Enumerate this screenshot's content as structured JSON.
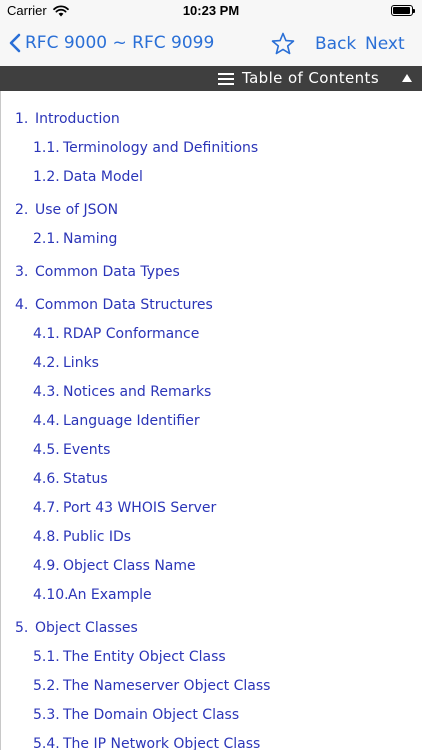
{
  "status_bar": {
    "carrier": "Carrier",
    "time": "10:23 PM"
  },
  "nav": {
    "title": "RFC 9000 ~ RFC 9099",
    "back_label": "Back",
    "next_label": "Next",
    "accent_color": "#2a6fd6"
  },
  "toc_header": {
    "label": "Table of Contents"
  },
  "toc": [
    {
      "num": "1.",
      "title": "Introduction",
      "level": 1
    },
    {
      "num": "1.1.",
      "title": "Terminology and Definitions",
      "level": 2
    },
    {
      "num": "1.2.",
      "title": "Data Model",
      "level": 2
    },
    {
      "num": "2.",
      "title": "Use of JSON",
      "level": 1
    },
    {
      "num": "2.1.",
      "title": "Naming",
      "level": 2
    },
    {
      "num": "3.",
      "title": "Common Data Types",
      "level": 1
    },
    {
      "num": "4.",
      "title": "Common Data Structures",
      "level": 1
    },
    {
      "num": "4.1.",
      "title": "RDAP Conformance",
      "level": 2
    },
    {
      "num": "4.2.",
      "title": "Links",
      "level": 2
    },
    {
      "num": "4.3.",
      "title": "Notices and Remarks",
      "level": 2
    },
    {
      "num": "4.4.",
      "title": "Language Identifier",
      "level": 2
    },
    {
      "num": "4.5.",
      "title": "Events",
      "level": 2
    },
    {
      "num": "4.6.",
      "title": "Status",
      "level": 2
    },
    {
      "num": "4.7.",
      "title": "Port 43 WHOIS Server",
      "level": 2
    },
    {
      "num": "4.8.",
      "title": "Public IDs",
      "level": 2
    },
    {
      "num": "4.9.",
      "title": "Object Class Name",
      "level": 2
    },
    {
      "num": "4.10.",
      "title": "An Example",
      "level": 2
    },
    {
      "num": "5.",
      "title": "Object Classes",
      "level": 1
    },
    {
      "num": "5.1.",
      "title": "The Entity Object Class",
      "level": 2
    },
    {
      "num": "5.2.",
      "title": "The Nameserver Object Class",
      "level": 2
    },
    {
      "num": "5.3.",
      "title": "The Domain Object Class",
      "level": 2
    },
    {
      "num": "5.4.",
      "title": "The IP Network Object Class",
      "level": 2
    }
  ]
}
